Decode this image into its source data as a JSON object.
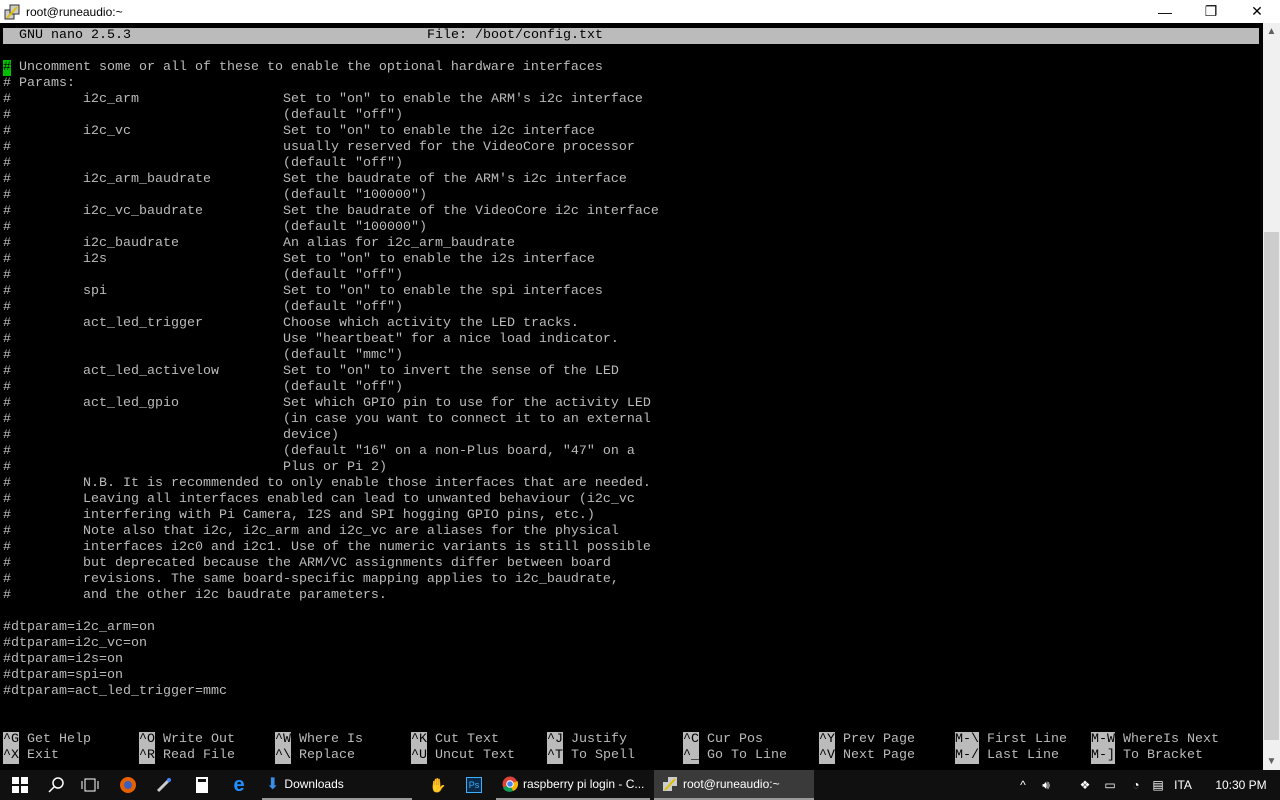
{
  "window": {
    "title": "root@runeaudio:~",
    "minimize": "—",
    "restore": "❐",
    "close": "✕"
  },
  "nano": {
    "version": "GNU nano 2.5.3",
    "file": "File: /boot/config.txt",
    "lines": [
      {
        "text": "# Uncomment some or all of these to enable the optional hardware interfaces",
        "cursor": true
      },
      {
        "text": "# Params:"
      },
      {
        "param": "i2c_arm",
        "desc": "Set to \"on\" to enable the ARM's i2c interface"
      },
      {
        "desc": "(default \"off\")"
      },
      {
        "param": "i2c_vc",
        "desc": "Set to \"on\" to enable the i2c interface"
      },
      {
        "desc": "usually reserved for the VideoCore processor"
      },
      {
        "desc": "(default \"off\")"
      },
      {
        "param": "i2c_arm_baudrate",
        "desc": "Set the baudrate of the ARM's i2c interface"
      },
      {
        "desc": "(default \"100000\")"
      },
      {
        "param": "i2c_vc_baudrate",
        "desc": "Set the baudrate of the VideoCore i2c interface"
      },
      {
        "desc": "(default \"100000\")"
      },
      {
        "param": "i2c_baudrate",
        "desc": "An alias for i2c_arm_baudrate"
      },
      {
        "param": "i2s",
        "desc": "Set to \"on\" to enable the i2s interface"
      },
      {
        "desc": "(default \"off\")"
      },
      {
        "param": "spi",
        "desc": "Set to \"on\" to enable the spi interfaces"
      },
      {
        "desc": "(default \"off\")"
      },
      {
        "param": "act_led_trigger",
        "desc": "Choose which activity the LED tracks."
      },
      {
        "desc": "Use \"heartbeat\" for a nice load indicator."
      },
      {
        "desc": "(default \"mmc\")"
      },
      {
        "param": "act_led_activelow",
        "desc": "Set to \"on\" to invert the sense of the LED"
      },
      {
        "desc": "(default \"off\")"
      },
      {
        "param": "act_led_gpio",
        "desc": "Set which GPIO pin to use for the activity LED"
      },
      {
        "desc": "(in case you want to connect it to an external"
      },
      {
        "desc": "device)"
      },
      {
        "desc": "(default \"16\" on a non-Plus board, \"47\" on a"
      },
      {
        "desc": "Plus or Pi 2)"
      },
      {
        "param": "N.B. It is recommended to only enable those interfaces that are needed."
      },
      {
        "param": "Leaving all interfaces enabled can lead to unwanted behaviour (i2c_vc"
      },
      {
        "param": "interfering with Pi Camera, I2S and SPI hogging GPIO pins, etc.)"
      },
      {
        "param": "Note also that i2c, i2c_arm and i2c_vc are aliases for the physical"
      },
      {
        "param": "interfaces i2c0 and i2c1. Use of the numeric variants is still possible"
      },
      {
        "param": "but deprecated because the ARM/VC assignments differ between board"
      },
      {
        "param": "revisions. The same board-specific mapping applies to i2c_baudrate,"
      },
      {
        "param": "and the other i2c baudrate parameters."
      },
      {
        "text": ""
      },
      {
        "text": "#dtparam=i2c_arm=on"
      },
      {
        "text": "#dtparam=i2c_vc=on"
      },
      {
        "text": "#dtparam=i2s=on"
      },
      {
        "text": "#dtparam=spi=on"
      },
      {
        "text": "#dtparam=act_led_trigger=mmc"
      }
    ],
    "shortcuts": [
      [
        {
          "key": "^G",
          "label": "Get Help"
        },
        {
          "key": "^X",
          "label": "Exit"
        }
      ],
      [
        {
          "key": "^O",
          "label": "Write Out"
        },
        {
          "key": "^R",
          "label": "Read File"
        }
      ],
      [
        {
          "key": "^W",
          "label": "Where Is"
        },
        {
          "key": "^\\",
          "label": "Replace"
        }
      ],
      [
        {
          "key": "^K",
          "label": "Cut Text"
        },
        {
          "key": "^U",
          "label": "Uncut Text"
        }
      ],
      [
        {
          "key": "^J",
          "label": "Justify"
        },
        {
          "key": "^T",
          "label": "To Spell"
        }
      ],
      [
        {
          "key": "^C",
          "label": "Cur Pos"
        },
        {
          "key": "^_",
          "label": "Go To Line"
        }
      ],
      [
        {
          "key": "^Y",
          "label": "Prev Page"
        },
        {
          "key": "^V",
          "label": "Next Page"
        }
      ],
      [
        {
          "key": "M-\\",
          "label": "First Line"
        },
        {
          "key": "M-/",
          "label": "Last Line"
        }
      ],
      [
        {
          "key": "M-W",
          "label": "WhereIs Next"
        },
        {
          "key": "M-]",
          "label": "To Bracket"
        }
      ]
    ]
  },
  "taskbar": {
    "downloads": "Downloads",
    "chrome": "raspberry pi login - C...",
    "putty": "root@runeaudio:~",
    "lang": "ITA",
    "time": "10:30 PM"
  }
}
